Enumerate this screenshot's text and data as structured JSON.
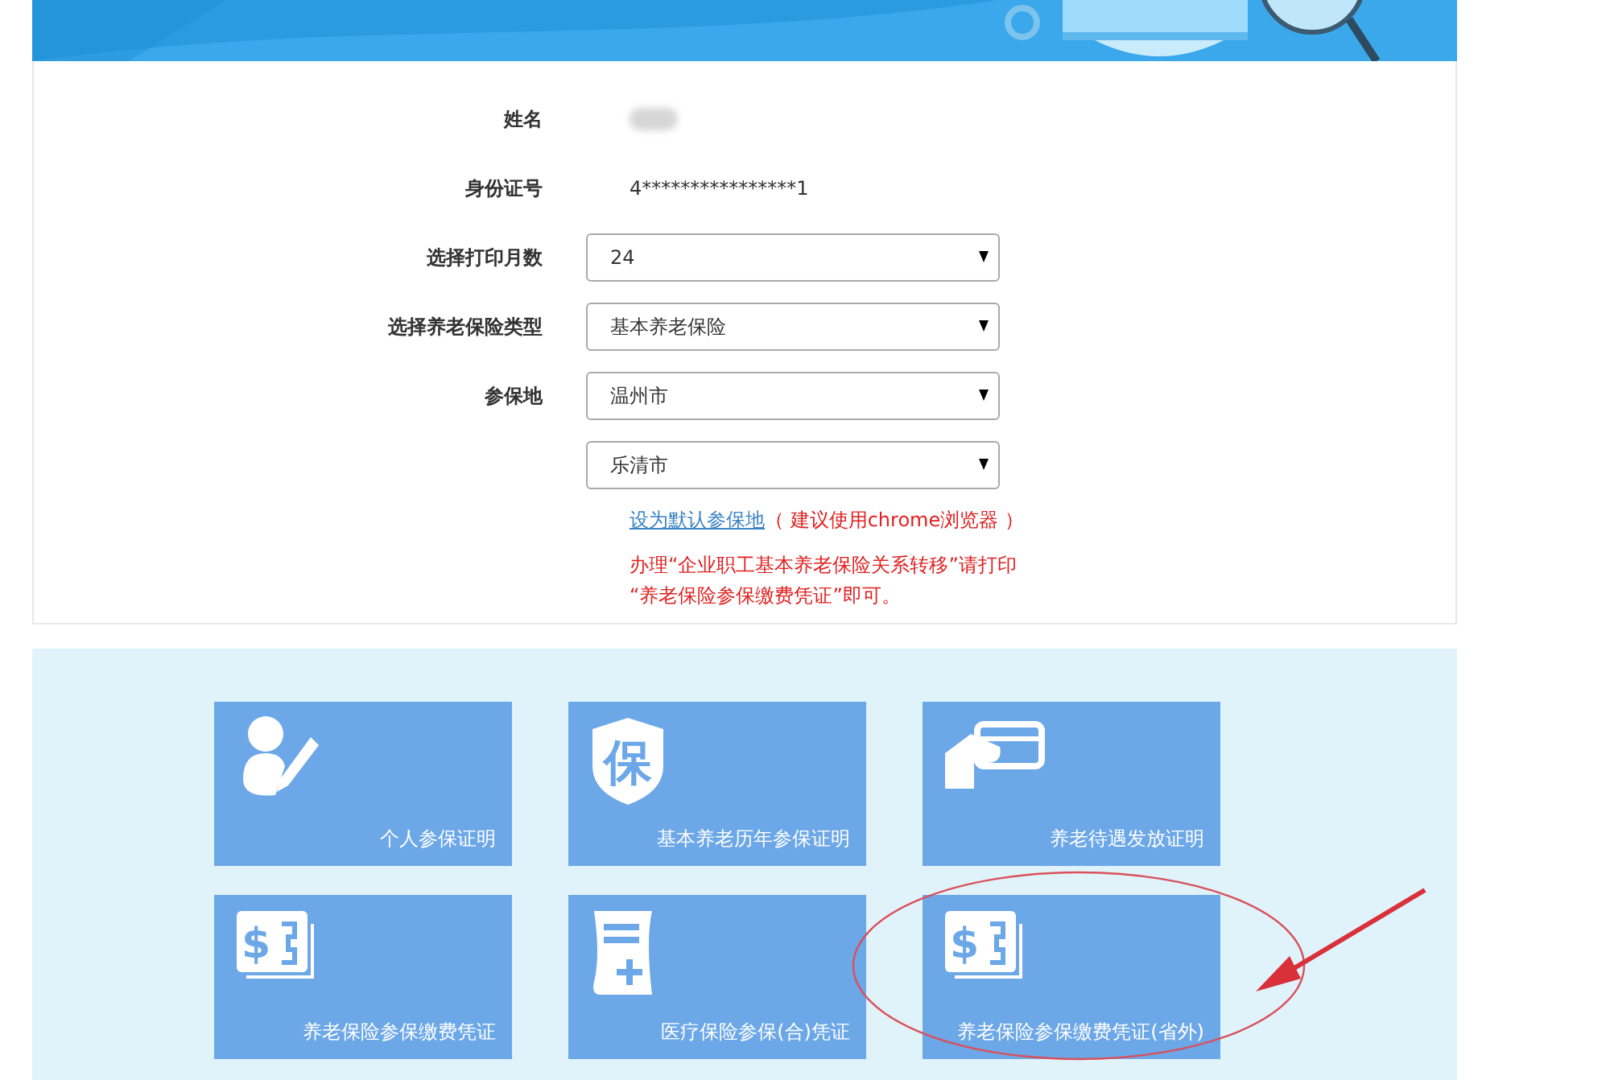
{
  "form": {
    "fields": [
      {
        "kind": "blurred",
        "label": "姓名"
      },
      {
        "kind": "text",
        "label": "身份证号",
        "value": "4****************1"
      },
      {
        "kind": "select",
        "label": "选择打印月数",
        "value": "24"
      },
      {
        "kind": "select",
        "label": "选择养老保险类型",
        "value": "基本养老保险"
      },
      {
        "kind": "select",
        "label": "参保地",
        "value": "温州市"
      },
      {
        "kind": "select",
        "value": "乐清市"
      }
    ],
    "default_link": "设为默认参保地",
    "browser_hint": "（ 建议使用chrome浏览器 ）",
    "notice": "办理“企业职工基本养老保险关系转移”请打印 “养老保险参保缴费凭证”即可。"
  },
  "tiles": [
    {
      "kind": "person",
      "label": "个人参保证明",
      "marked": false
    },
    {
      "kind": "shield",
      "glyph": "保",
      "label": "基本养老历年参保证明",
      "marked": false
    },
    {
      "kind": "card",
      "label": "养老待遇发放证明",
      "marked": false
    },
    {
      "kind": "payment",
      "glyph": "$",
      "label": "养老保险参保缴费凭证",
      "marked": false
    },
    {
      "kind": "medical",
      "label": "医疗保险参保(合)凭证",
      "marked": false
    },
    {
      "kind": "payment",
      "glyph": "$",
      "label": "养老保险参保缴费凭证(省外)",
      "marked": true
    }
  ]
}
